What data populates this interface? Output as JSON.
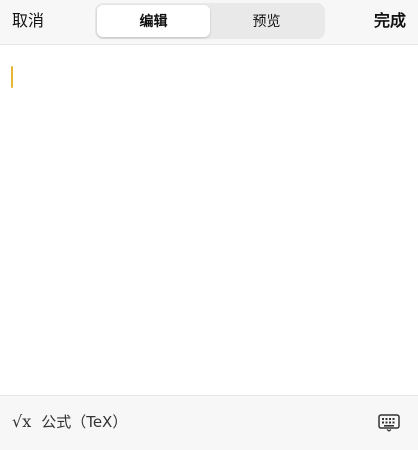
{
  "topbar": {
    "cancel_label": "取消",
    "done_label": "完成",
    "tabs": [
      {
        "label": "编辑",
        "active": true
      },
      {
        "label": "预览",
        "active": false
      }
    ]
  },
  "editor": {
    "content": "",
    "caret_color": "#e6b832"
  },
  "bottombar": {
    "formula_icon": "√x",
    "formula_label": "公式（TeX）",
    "keyboard_icon": "keyboard-icon"
  }
}
